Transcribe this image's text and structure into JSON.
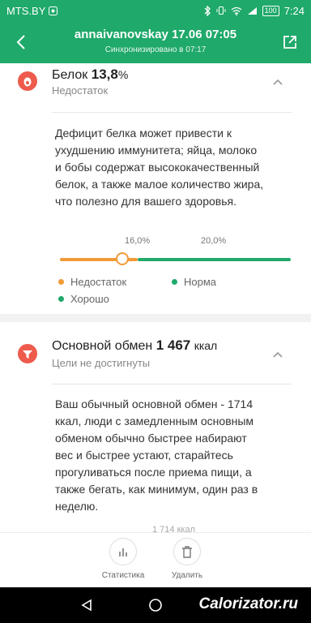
{
  "status_bar": {
    "carrier": "MTS.BY",
    "battery": "100",
    "time": "7:24"
  },
  "header": {
    "title": "annaivanovskay 17.06 07:05",
    "subtitle": "Синхронизировано в 07:17"
  },
  "protein": {
    "label": "Белок",
    "value": "13,8",
    "unit": "%",
    "status": "Недостаток",
    "description_lines": [
      "Дефицит белка может привести к",
      "ухудшению иммунитета; яйца, молоко",
      "и бобы содержат высококачественный",
      "белок, а также малое количество жира,",
      "что полезно для вашего здоровья."
    ],
    "thresholds": [
      "16,0%",
      "20,0%"
    ],
    "level_fraction": 0.27,
    "legend": [
      "Недостаток",
      "Норма",
      "Хорошо"
    ]
  },
  "bmr": {
    "label": "Основной обмен",
    "value": "1 467",
    "unit": "ккал",
    "status": "Цели не достигнуты",
    "description_lines": [
      "Ваш обычный основной обмен - 1714",
      "ккал, люди с замедленным основным",
      "обменом обычно быстрее набирают",
      "вес и быстрее устают, старайтесь",
      "прогуливаться после приема пищи, а",
      "также бегать, как минимум, один раз в",
      "неделю."
    ],
    "partial_label": "1 714 ккал"
  },
  "actions": {
    "stats_label": "Статистика",
    "delete_label": "Удалить"
  },
  "watermark": "Calorizator.ru",
  "colors": {
    "brand_green": "#1fa96a",
    "deficit_orange": "#f19a36",
    "norm_green": "#1fa96a",
    "icon_red": "#ee5b4c"
  },
  "icons": {
    "back": "back-arrow-icon",
    "share": "share-icon",
    "protein": "egg-icon",
    "bmr": "funnel-icon",
    "collapse": "chevron-up-icon",
    "stats": "bar-chart-icon",
    "delete": "trash-icon"
  }
}
